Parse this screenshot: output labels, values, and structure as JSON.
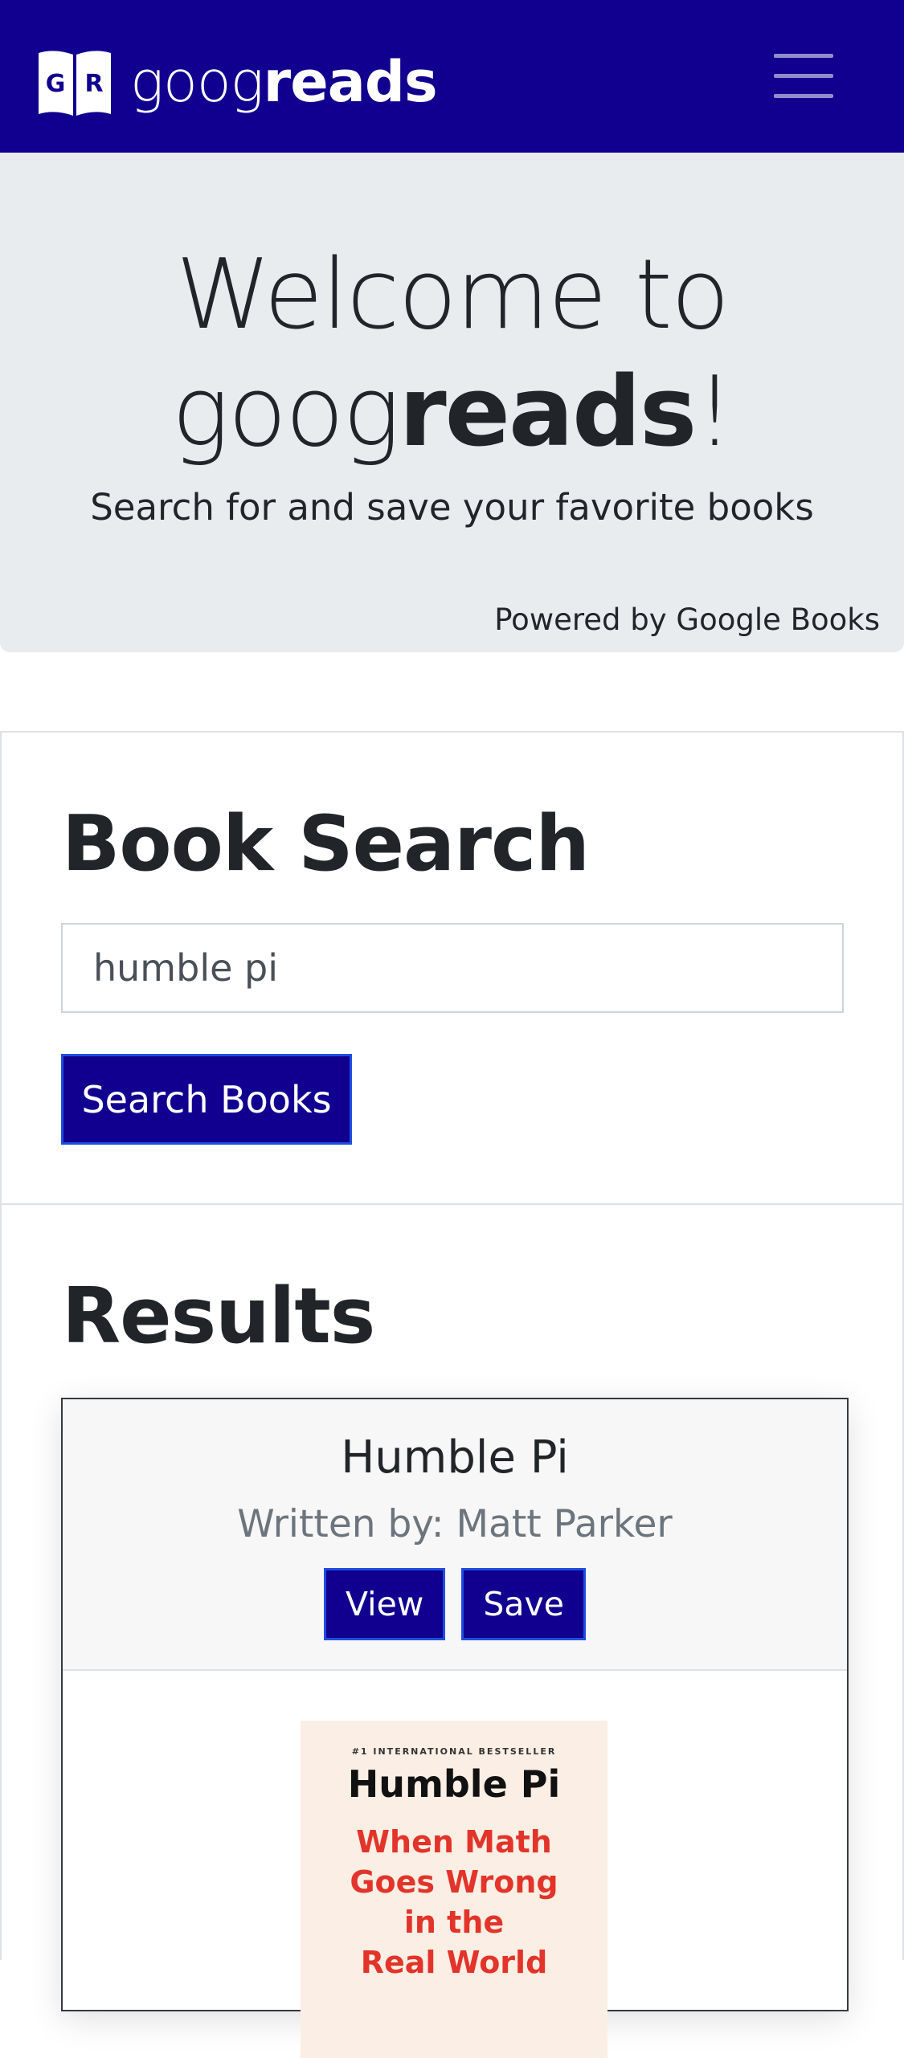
{
  "navbar": {
    "logo_letters": [
      "G",
      "R"
    ],
    "brand_light": "goog",
    "brand_bold": "reads",
    "menu_icon": "hamburger-menu-icon",
    "colors": {
      "navbar_bg": "#11008f",
      "accent_border": "#1f4de0"
    }
  },
  "jumbotron": {
    "title_line1": "Welcome to",
    "title_light": "goog",
    "title_bold": "reads",
    "title_end": "!",
    "lead": "Search for and save your favorite books",
    "powered_by": "Powered by Google Books"
  },
  "search": {
    "heading": "Book Search",
    "input_value": "humble pi",
    "button_label": "Search Books"
  },
  "results": {
    "heading": "Results",
    "items": [
      {
        "title": "Humble Pi",
        "author": "Written by: Matt Parker",
        "view_label": "View",
        "save_label": "Save",
        "cover": {
          "tag": "#1 INTERNATIONAL BESTSELLER",
          "title": "Humble Pi",
          "subtitle_lines": [
            "When Math",
            "Goes Wrong",
            "in the",
            "Real World"
          ]
        }
      }
    ]
  }
}
